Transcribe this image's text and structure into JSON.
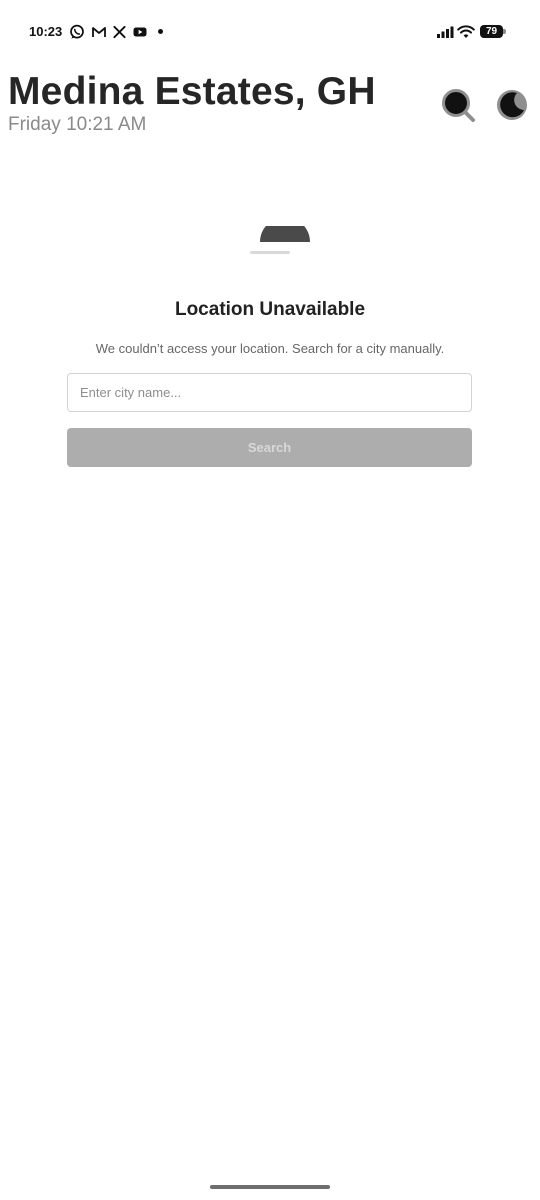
{
  "status_bar": {
    "time": "10:23",
    "left_icons": [
      "whatsapp-icon",
      "gmail-icon",
      "x-icon",
      "youtube-icon",
      "notification-dot-icon"
    ],
    "right_icons": [
      "cellular-signal-icon",
      "wifi-icon",
      "battery-icon"
    ],
    "battery_level": "79"
  },
  "header": {
    "title": "Medina Estates, GH",
    "subtitle": "Friday 10:21 AM",
    "search_icon": "search-icon",
    "theme_icon": "moon-icon"
  },
  "location_error": {
    "title": "Location Unavailable",
    "message": "We couldn’t access your location. Search for a city manually.",
    "input_placeholder": "Enter city name...",
    "input_value": "",
    "search_label": "Search"
  },
  "colors": {
    "text_primary": "#262626",
    "text_secondary": "#8a8a8a",
    "button_disabled": "#adadad",
    "loader": "#4a4a4a"
  }
}
